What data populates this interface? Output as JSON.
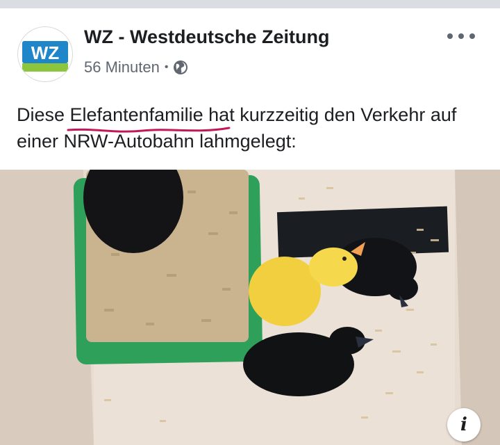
{
  "post": {
    "page_name": "WZ - Westdeutsche Zeitung",
    "logo_text": "WZ",
    "time_ago": "56 Minuten",
    "separator": "•",
    "audience_icon": "globe-icon",
    "menu_icon": "more-options-icon",
    "text_before": "Diese ",
    "text_highlight": "Elefantenfamilie",
    "text_after": " hat kurzzeitig den Verkehr auf einer NRW-Autobahn lahmgelegt:",
    "info_label": "i",
    "image_subject": "ducklings in cardboard box with green pellet tray"
  },
  "colors": {
    "logo_blue": "#1f86c9",
    "logo_green": "#8cc63f",
    "highlight_underline": "#c2185b",
    "tray_green": "#2fa05a"
  }
}
